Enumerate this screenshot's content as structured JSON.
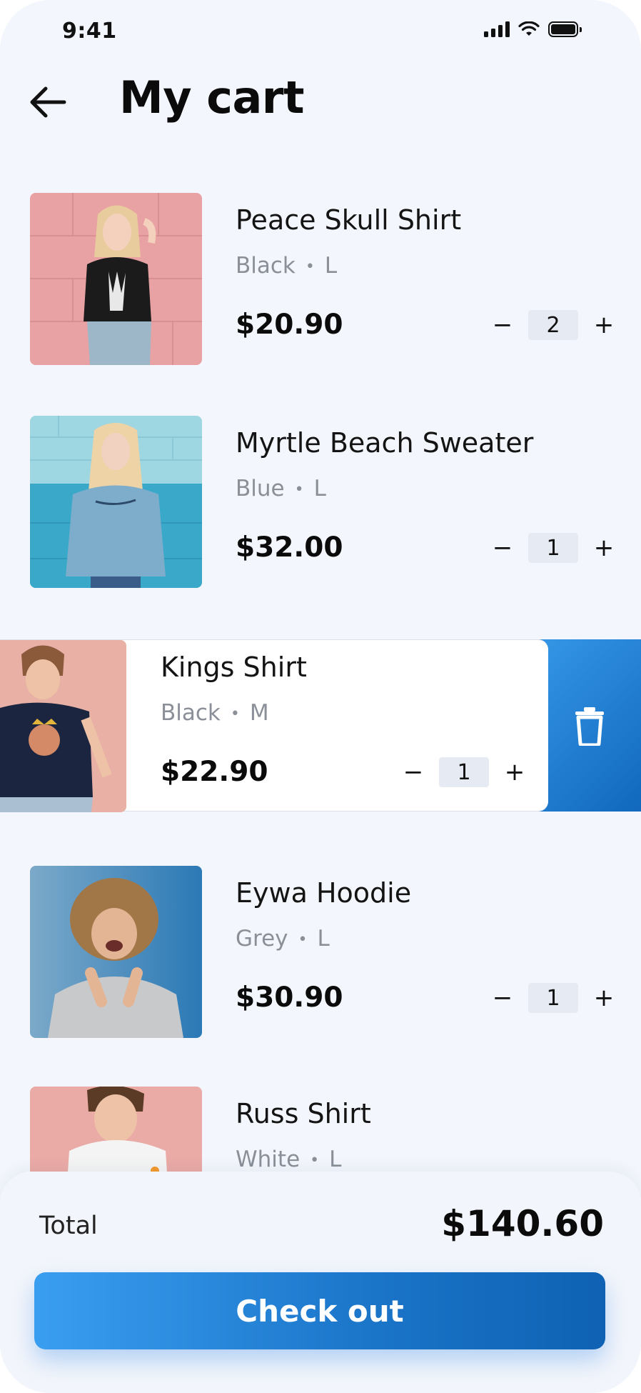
{
  "status_bar": {
    "time": "9:41"
  },
  "header": {
    "title": "My cart"
  },
  "items": [
    {
      "name": "Peace Skull Shirt",
      "color": "Black",
      "size": "L",
      "price": "$20.90",
      "qty": "2"
    },
    {
      "name": "Myrtle Beach Sweater",
      "color": "Blue",
      "size": "L",
      "price": "$32.00",
      "qty": "1"
    },
    {
      "name": "Kings Shirt",
      "color": "Black",
      "size": "M",
      "price": "$22.90",
      "qty": "1"
    },
    {
      "name": "Eywa Hoodie",
      "color": "Grey",
      "size": "L",
      "price": "$30.90",
      "qty": "1"
    },
    {
      "name": "Russ Shirt",
      "color": "White",
      "size": "L"
    }
  ],
  "qty_controls": {
    "minus": "−",
    "plus": "+"
  },
  "variant_separator": "•",
  "summary": {
    "total_label": "Total",
    "total_value": "$140.60",
    "checkout_label": "Check out"
  },
  "colors": {
    "accent": "#2d8be0",
    "accent_dark": "#0f62b3",
    "background": "#f3f6fc"
  }
}
